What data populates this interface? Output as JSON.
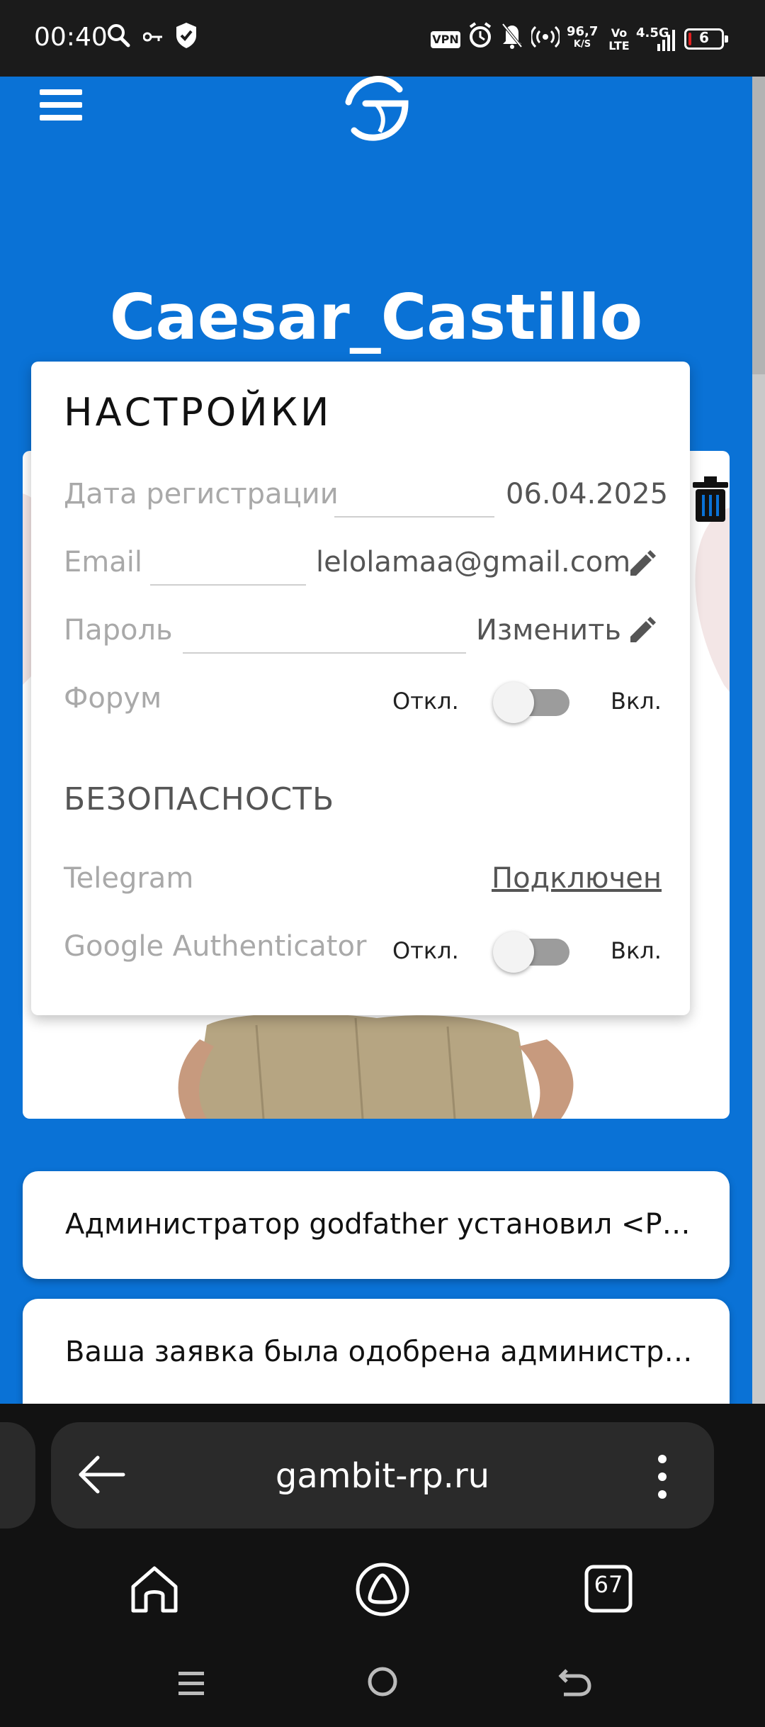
{
  "status_bar": {
    "time": "00:40",
    "vpn_badge": "VPN",
    "net_speed": "96,7",
    "net_speed_unit": "K/S",
    "volte_top": "Vo",
    "volte_bottom": "LTE",
    "network_type": "4.5G",
    "battery_level": "6"
  },
  "header": {
    "username": "Caesar_Castillo"
  },
  "settings": {
    "title": "НАСТРОЙКИ",
    "registration_label": "Дата регистрации",
    "registration_value": "06.04.2025",
    "email_label": "Email",
    "email_value": "lelolamaa@gmail.com",
    "password_label": "Пароль",
    "password_action": "Изменить",
    "forum_label": "Форум",
    "forum_off": "Откл.",
    "forum_on": "Вкл.",
    "security_title": "БЕЗОПАСНОСТЬ",
    "telegram_label": "Telegram",
    "telegram_value": "Подключен",
    "google_auth_label": "Google Authenticator",
    "google_auth_off": "Откл.",
    "google_auth_on": "Вкл."
  },
  "notifications": [
    {
      "text": "Администратор godfather установил <PK..."
    },
    {
      "text": "Ваша заявка была одобрена администра..."
    }
  ],
  "browser": {
    "url": "gambit-rp.ru",
    "tabs_count": "67"
  },
  "colors": {
    "page_bg": "#0a72d6",
    "card_bg": "#ffffff",
    "browser_bg": "#121212"
  },
  "icons": [
    "menu-icon",
    "logo-icon",
    "trash-icon",
    "pencil-icon",
    "back-arrow-icon",
    "more-icon",
    "home-icon",
    "alice-icon",
    "tabs-icon"
  ]
}
